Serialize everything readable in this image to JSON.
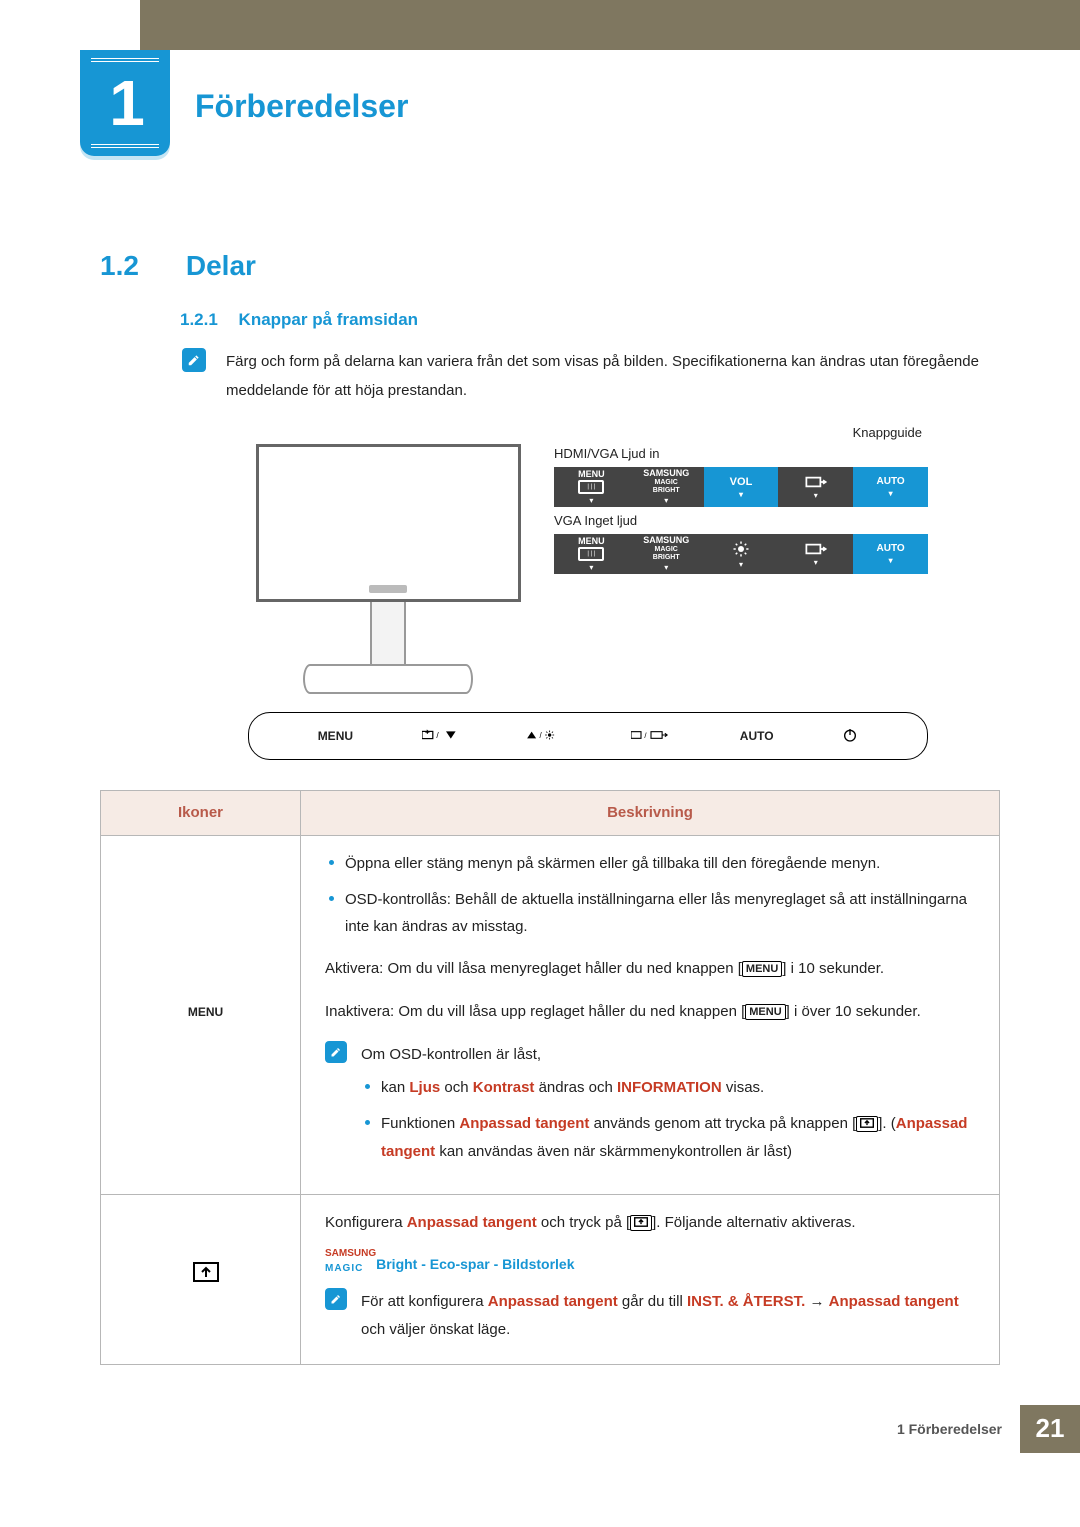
{
  "chapter": {
    "number": "1",
    "title": "Förberedelser"
  },
  "section": {
    "number": "1.2",
    "title": "Delar"
  },
  "subsection": {
    "number": "1.2.1",
    "title": "Knappar på framsidan"
  },
  "intro_note": "Färg och form på delarna kan variera från det som visas på bilden. Specifikationerna kan ändras utan föregående meddelande för att höja prestandan.",
  "diagram": {
    "knapp_label": "Knappguide",
    "row1_caption": "HDMI/VGA Ljud in",
    "row2_caption": "VGA Inget ljud",
    "osd": {
      "menu": "MENU",
      "samsung": "SAMSUNG",
      "magic": "MAGIC",
      "bright": "BRIGHT",
      "vol": "VOL",
      "auto": "AUTO"
    },
    "bar": {
      "menu": "MENU",
      "auto": "AUTO"
    }
  },
  "table": {
    "h1": "Ikoner",
    "h2": "Beskrivning",
    "row1": {
      "icon": "MENU",
      "b1": "Öppna eller stäng menyn på skärmen eller gå tillbaka till den föregående menyn.",
      "b2": "OSD-kontrollås: Behåll de aktuella inställningarna eller lås menyreglaget så att inställningarna inte kan ändras av misstag.",
      "activate_pre": "Aktivera: Om du vill låsa menyreglaget håller du ned knappen [",
      "activate_post": "] i 10 sekunder.",
      "deactivate_pre": "Inaktivera: Om du vill låsa upp reglaget håller du ned knappen [",
      "deactivate_post": "] i över 10 sekunder.",
      "note_lead": "Om OSD-kontrollen är låst,",
      "note_b1_a": "kan ",
      "note_b1_b": " och ",
      "note_b1_c": " ändras och ",
      "note_b1_d": " visas.",
      "kw_ljus": "Ljus",
      "kw_kontrast": "Kontrast",
      "kw_info": "INFORMATION",
      "note_b2_a": "Funktionen ",
      "note_b2_b": " används genom att trycka på knappen [",
      "note_b2_c": "]. (",
      "note_b2_d": " kan användas även när skärmmenykontrollen är låst)",
      "kw_anpassad": "Anpassad tangent"
    },
    "row2": {
      "p1a": "Konfigurera ",
      "p1b": " och tryck på [",
      "p1c": "]. Följande alternativ aktiveras.",
      "magic_samsung": "SAMSUNG",
      "magic_magic": "MAGIC",
      "magic_line_rest": "Bright - Eco-spar - Bildstorlek",
      "note_a": "För att konfigurera ",
      "note_b": " går du till ",
      "kw_inst": "INST. & ÅTERST.",
      "note_c": " → ",
      "note_d": " och väljer önskat läge.",
      "kw_anpassad": "Anpassad tangent"
    }
  },
  "footer": {
    "label": "1 Förberedelser",
    "page": "21"
  }
}
